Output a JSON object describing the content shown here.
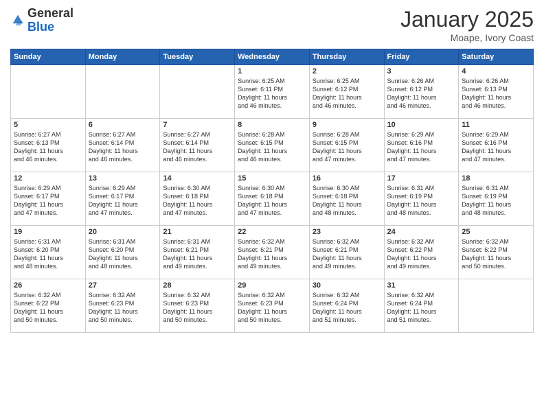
{
  "logo": {
    "general": "General",
    "blue": "Blue"
  },
  "title": "January 2025",
  "subtitle": "Moape, Ivory Coast",
  "weekdays": [
    "Sunday",
    "Monday",
    "Tuesday",
    "Wednesday",
    "Thursday",
    "Friday",
    "Saturday"
  ],
  "weeks": [
    [
      {
        "day": "",
        "info": ""
      },
      {
        "day": "",
        "info": ""
      },
      {
        "day": "",
        "info": ""
      },
      {
        "day": "1",
        "info": "Sunrise: 6:25 AM\nSunset: 6:11 PM\nDaylight: 11 hours\nand 46 minutes."
      },
      {
        "day": "2",
        "info": "Sunrise: 6:25 AM\nSunset: 6:12 PM\nDaylight: 11 hours\nand 46 minutes."
      },
      {
        "day": "3",
        "info": "Sunrise: 6:26 AM\nSunset: 6:12 PM\nDaylight: 11 hours\nand 46 minutes."
      },
      {
        "day": "4",
        "info": "Sunrise: 6:26 AM\nSunset: 6:13 PM\nDaylight: 11 hours\nand 46 minutes."
      }
    ],
    [
      {
        "day": "5",
        "info": "Sunrise: 6:27 AM\nSunset: 6:13 PM\nDaylight: 11 hours\nand 46 minutes."
      },
      {
        "day": "6",
        "info": "Sunrise: 6:27 AM\nSunset: 6:14 PM\nDaylight: 11 hours\nand 46 minutes."
      },
      {
        "day": "7",
        "info": "Sunrise: 6:27 AM\nSunset: 6:14 PM\nDaylight: 11 hours\nand 46 minutes."
      },
      {
        "day": "8",
        "info": "Sunrise: 6:28 AM\nSunset: 6:15 PM\nDaylight: 11 hours\nand 46 minutes."
      },
      {
        "day": "9",
        "info": "Sunrise: 6:28 AM\nSunset: 6:15 PM\nDaylight: 11 hours\nand 47 minutes."
      },
      {
        "day": "10",
        "info": "Sunrise: 6:29 AM\nSunset: 6:16 PM\nDaylight: 11 hours\nand 47 minutes."
      },
      {
        "day": "11",
        "info": "Sunrise: 6:29 AM\nSunset: 6:16 PM\nDaylight: 11 hours\nand 47 minutes."
      }
    ],
    [
      {
        "day": "12",
        "info": "Sunrise: 6:29 AM\nSunset: 6:17 PM\nDaylight: 11 hours\nand 47 minutes."
      },
      {
        "day": "13",
        "info": "Sunrise: 6:29 AM\nSunset: 6:17 PM\nDaylight: 11 hours\nand 47 minutes."
      },
      {
        "day": "14",
        "info": "Sunrise: 6:30 AM\nSunset: 6:18 PM\nDaylight: 11 hours\nand 47 minutes."
      },
      {
        "day": "15",
        "info": "Sunrise: 6:30 AM\nSunset: 6:18 PM\nDaylight: 11 hours\nand 47 minutes."
      },
      {
        "day": "16",
        "info": "Sunrise: 6:30 AM\nSunset: 6:18 PM\nDaylight: 11 hours\nand 48 minutes."
      },
      {
        "day": "17",
        "info": "Sunrise: 6:31 AM\nSunset: 6:19 PM\nDaylight: 11 hours\nand 48 minutes."
      },
      {
        "day": "18",
        "info": "Sunrise: 6:31 AM\nSunset: 6:19 PM\nDaylight: 11 hours\nand 48 minutes."
      }
    ],
    [
      {
        "day": "19",
        "info": "Sunrise: 6:31 AM\nSunset: 6:20 PM\nDaylight: 11 hours\nand 48 minutes."
      },
      {
        "day": "20",
        "info": "Sunrise: 6:31 AM\nSunset: 6:20 PM\nDaylight: 11 hours\nand 48 minutes."
      },
      {
        "day": "21",
        "info": "Sunrise: 6:31 AM\nSunset: 6:21 PM\nDaylight: 11 hours\nand 49 minutes."
      },
      {
        "day": "22",
        "info": "Sunrise: 6:32 AM\nSunset: 6:21 PM\nDaylight: 11 hours\nand 49 minutes."
      },
      {
        "day": "23",
        "info": "Sunrise: 6:32 AM\nSunset: 6:21 PM\nDaylight: 11 hours\nand 49 minutes."
      },
      {
        "day": "24",
        "info": "Sunrise: 6:32 AM\nSunset: 6:22 PM\nDaylight: 11 hours\nand 49 minutes."
      },
      {
        "day": "25",
        "info": "Sunrise: 6:32 AM\nSunset: 6:22 PM\nDaylight: 11 hours\nand 50 minutes."
      }
    ],
    [
      {
        "day": "26",
        "info": "Sunrise: 6:32 AM\nSunset: 6:22 PM\nDaylight: 11 hours\nand 50 minutes."
      },
      {
        "day": "27",
        "info": "Sunrise: 6:32 AM\nSunset: 6:23 PM\nDaylight: 11 hours\nand 50 minutes."
      },
      {
        "day": "28",
        "info": "Sunrise: 6:32 AM\nSunset: 6:23 PM\nDaylight: 11 hours\nand 50 minutes."
      },
      {
        "day": "29",
        "info": "Sunrise: 6:32 AM\nSunset: 6:23 PM\nDaylight: 11 hours\nand 50 minutes."
      },
      {
        "day": "30",
        "info": "Sunrise: 6:32 AM\nSunset: 6:24 PM\nDaylight: 11 hours\nand 51 minutes."
      },
      {
        "day": "31",
        "info": "Sunrise: 6:32 AM\nSunset: 6:24 PM\nDaylight: 11 hours\nand 51 minutes."
      },
      {
        "day": "",
        "info": ""
      }
    ]
  ]
}
